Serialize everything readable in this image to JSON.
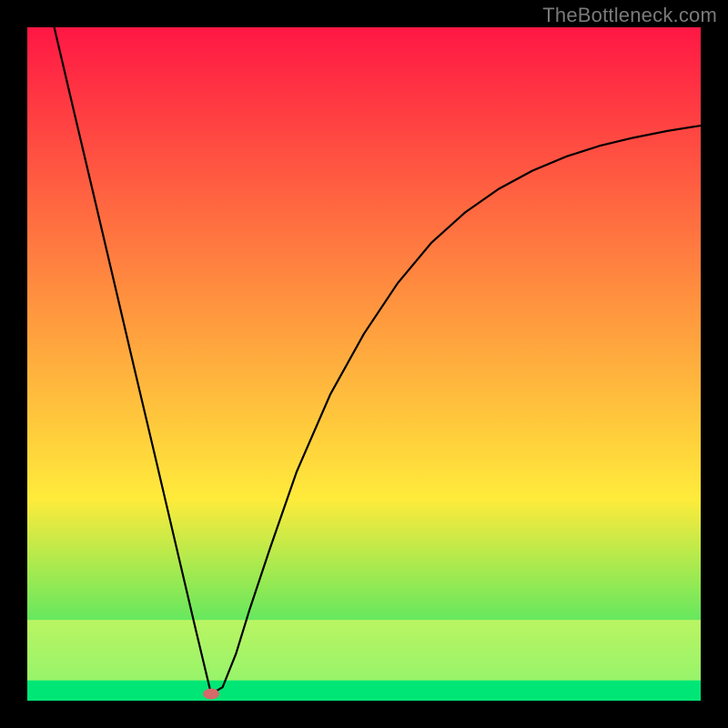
{
  "attribution": "TheBottleneck.com",
  "chart_data": {
    "type": "line",
    "title": "",
    "xlabel": "",
    "ylabel": "",
    "xlim": [
      0,
      1
    ],
    "ylim": [
      0,
      1
    ],
    "grid": false,
    "legend": false,
    "background_gradient": [
      "#ff1744",
      "#ffeb3b",
      "#00e676"
    ],
    "wide_bands": [
      {
        "color_idx": 0,
        "y": 0.03
      },
      {
        "color_idx": 1,
        "y": 0.08
      }
    ],
    "series": [
      {
        "name": "curve",
        "color": "#000000",
        "x": [
          0.04,
          0.07,
          0.1,
          0.13,
          0.16,
          0.19,
          0.22,
          0.25,
          0.273,
          0.29,
          0.31,
          0.33,
          0.36,
          0.4,
          0.45,
          0.5,
          0.55,
          0.6,
          0.65,
          0.7,
          0.75,
          0.8,
          0.85,
          0.9,
          0.95,
          1.0
        ],
        "y": [
          1.0,
          0.872,
          0.745,
          0.617,
          0.489,
          0.362,
          0.234,
          0.106,
          0.01,
          0.02,
          0.07,
          0.135,
          0.225,
          0.34,
          0.455,
          0.545,
          0.62,
          0.68,
          0.725,
          0.76,
          0.787,
          0.808,
          0.824,
          0.836,
          0.846,
          0.854
        ]
      }
    ],
    "marker": {
      "x": 0.273,
      "y": 0.01,
      "rx": 0.012,
      "ry": 0.008,
      "color": "#d46a6a"
    }
  }
}
